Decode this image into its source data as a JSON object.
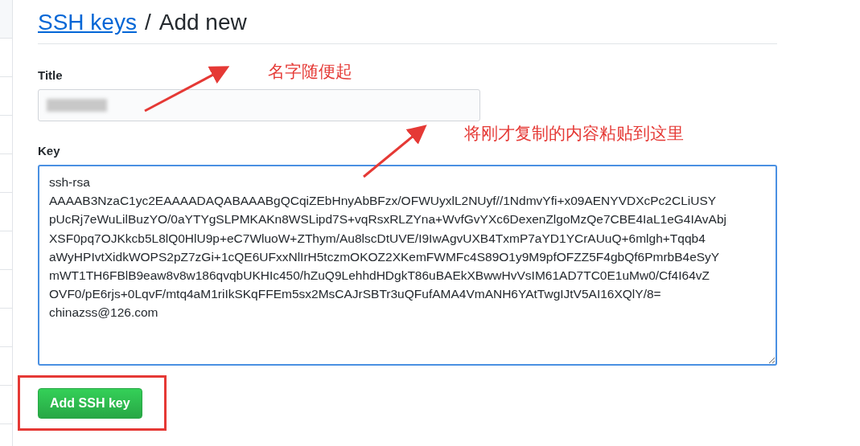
{
  "breadcrumb": {
    "link": "SSH keys",
    "separator": "/",
    "current": "Add new"
  },
  "form": {
    "title_label": "Title",
    "key_label": "Key",
    "key_lines": [
      "ssh-rsa",
      "AAAAB3NzaC1yc2EAAAADAQABAAABgQCqiZEbHnyAbBFzx/OFWUyxlL2NUyf//1NdmvYfi+x09AENYVDXcPc2CLiUSY",
      "pUcRj7eWuLilBuzYO/0aYTYgSLPMKAKn8WSLipd7S+vqRsxRLZYna+WvfGvYXc6DexenZlgoMzQe7CBE4IaL1eG4IAvAbj",
      "XSF0pq7OJKkcb5L8lQ0HlU9p+eC7WluoW+ZThym/Au8lscDtUVE/I9IwAgvUXB4TxmP7aYD1YCrAUuQ+6mlgh+Tqqb4",
      "aWyHPIvtXidkWOPS2pZ7zGi+1cQE6UFxxNlIrH5tczmOKOZ2XKemFWMFc4S89O1y9M9pfOFZZ5F4gbQf6PmrbB4eSyY",
      "mWT1TH6FBlB9eaw8v8w186qvqbUKHIc450/hZuQ9LehhdHDgkT86uBAEkXBwwHvVsIM61AD7TC0E1uMw0/Cf4I64vZ",
      "OVF0/pE6rjs+0LqvF/mtq4aM1riIkSKqFFEm5sx2MsCAJrSBTr3uQFufAMA4VmANH6YAtTwgIJtV5AI16XQlY/8=",
      "chinazss@126.com"
    ],
    "submit": "Add SSH key"
  },
  "annotations": [
    "名字随便起",
    "将刚才复制的内容粘贴到这里"
  ]
}
